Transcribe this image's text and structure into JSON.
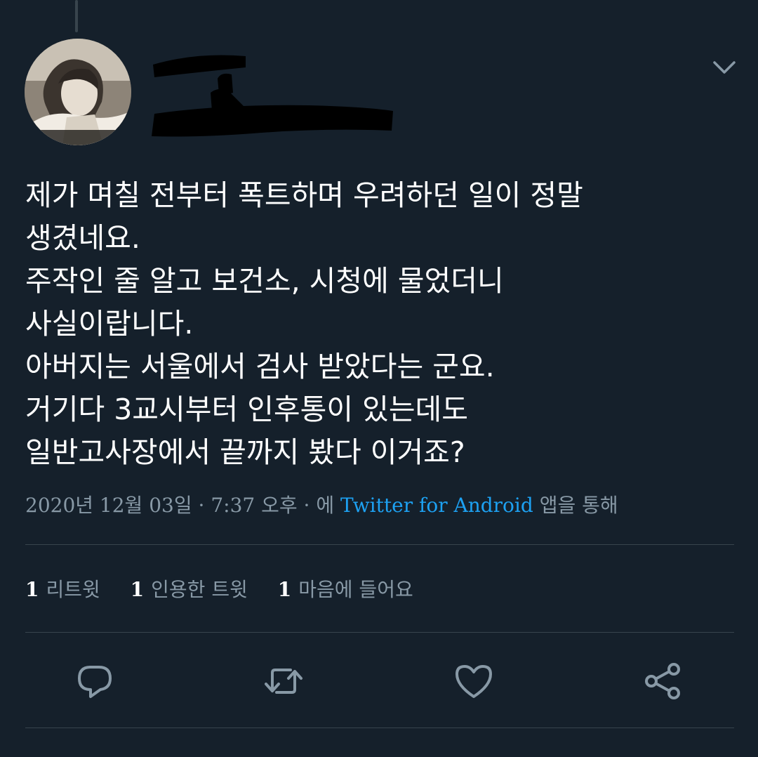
{
  "tweet": {
    "lines": [
      "제가 며칠 전부터 폭트하며 우려하던 일이 정말",
      "생겼네요.",
      "주작인 줄 알고 보건소, 시청에 물었더니",
      "사실이랍니다.",
      "아버지는 서울에서 검사 받았다는 군요.",
      "거기다 3교시부터 인후통이 있는데도",
      "일반고사장에서 끝까지 봤다 이거죠?"
    ],
    "date": "2020년 12월 03일",
    "separator": "·",
    "time": "7:37 오후",
    "source_prefix": "에",
    "source": "Twitter for Android",
    "source_suffix": "앱을 통해"
  },
  "stats": {
    "retweets": {
      "count": "1",
      "label": "리트윗"
    },
    "quotes": {
      "count": "1",
      "label": "인용한 트윗"
    },
    "likes": {
      "count": "1",
      "label": "마음에 들어요"
    }
  },
  "icons": {
    "reply": "reply-icon",
    "retweet": "retweet-icon",
    "like": "heart-icon",
    "share": "share-icon",
    "menu": "chevron-down-icon"
  },
  "colors": {
    "background": "#15202b",
    "text": "#ffffff",
    "muted": "#8899a6",
    "link": "#1da1f2",
    "divider": "#38444d"
  }
}
